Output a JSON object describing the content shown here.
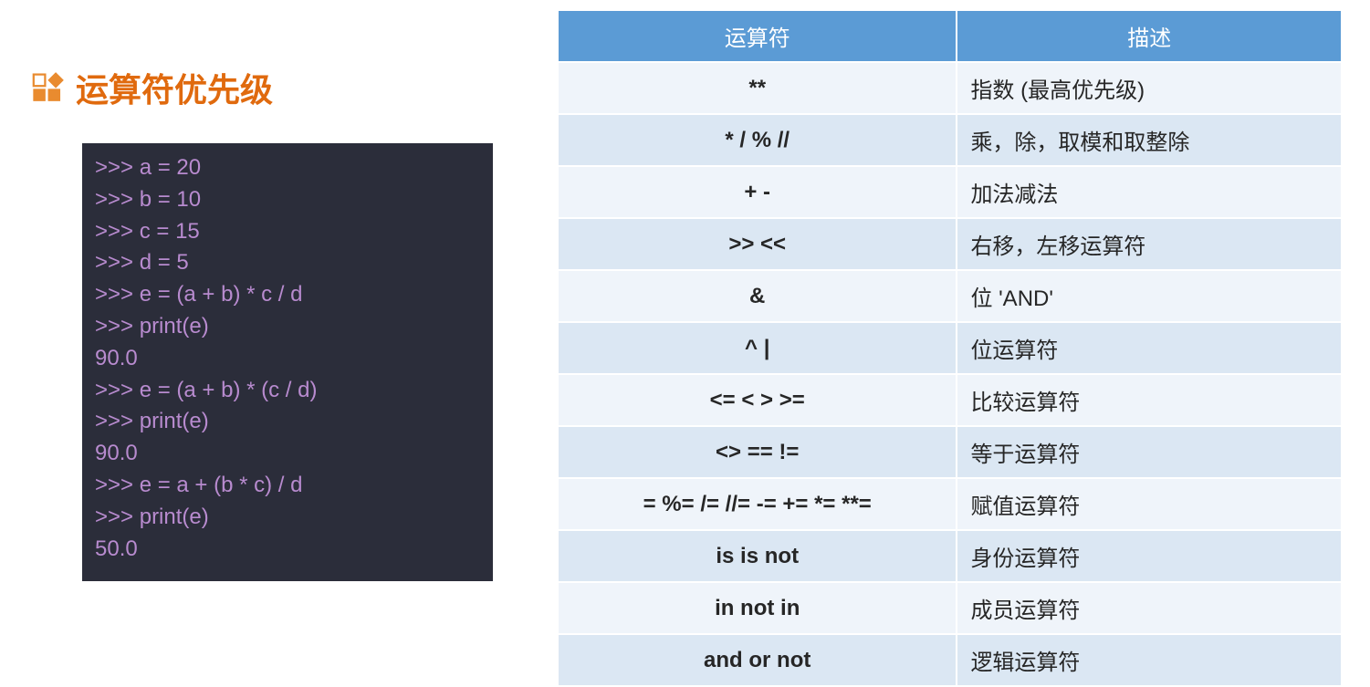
{
  "title": "运算符优先级",
  "code_lines": [
    ">>> a = 20",
    ">>> b = 10",
    ">>> c = 15",
    ">>> d = 5",
    ">>> e = (a + b) * c / d",
    ">>> print(e)",
    "90.0",
    ">>> e = (a + b) * (c / d)",
    ">>> print(e)",
    "90.0",
    ">>> e = a + (b * c) / d",
    ">>> print(e)",
    "50.0"
  ],
  "table": {
    "headers": [
      "运算符",
      "描述"
    ],
    "rows": [
      {
        "op": "**",
        "desc": "指数 (最高优先级)"
      },
      {
        "op": "* / % //",
        "desc": "乘，除，取模和取整除"
      },
      {
        "op": "+ -",
        "desc": "加法减法"
      },
      {
        "op": ">> <<",
        "desc": "右移，左移运算符"
      },
      {
        "op": "&",
        "desc": "位 'AND'"
      },
      {
        "op": "^ |",
        "desc": "位运算符"
      },
      {
        "op": "<= < > >=",
        "desc": "比较运算符"
      },
      {
        "op": "<> == !=",
        "desc": "等于运算符"
      },
      {
        "op": "= %= /= //= -= += *= **=",
        "desc": "赋值运算符"
      },
      {
        "op": "is is not",
        "desc": "身份运算符"
      },
      {
        "op": "in not in",
        "desc": "成员运算符"
      },
      {
        "op": "and or not",
        "desc": "逻辑运算符"
      }
    ]
  }
}
